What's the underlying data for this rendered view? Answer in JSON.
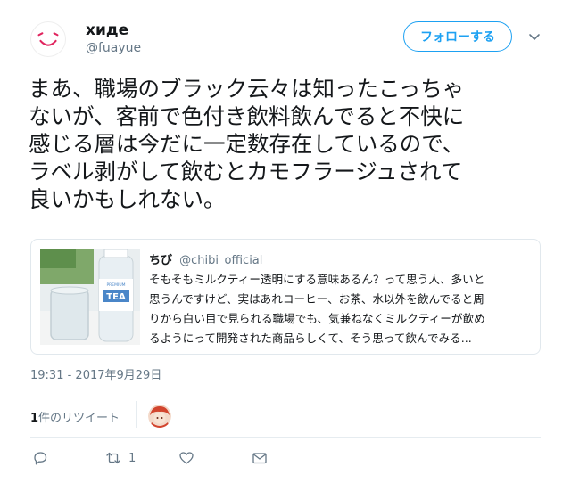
{
  "author": {
    "name": "хиде",
    "handle": "@fuayue",
    "follow_label": "フォローする"
  },
  "tweet": {
    "lines": [
      "まあ、職場のブラック云々は知ったこっちゃ",
      "ないが、客前で色付き飲料飲んでると不快に",
      "感じる層は今だに一定数存在しているので、",
      "ラベル剥がして飲むとカモフラージュされて",
      "良いかもしれない。"
    ]
  },
  "quote": {
    "name": "ちび",
    "handle": "@chibi_official",
    "lines": [
      "そもそもミルクティー透明にする意味あるん？って思う人、多いと",
      "思うんですけど、実はあれコーヒー、お茶、水以外を飲んでると周",
      "りから白い目で見られる職場でも、気兼ねなくミルクティーが飲め",
      "るようにって開発された商品らしくて、そう思って飲んでみる..."
    ]
  },
  "timestamp": "19:31 - 2017年9月29日",
  "retweets": {
    "count": "1",
    "label": "件のリツイート"
  },
  "actions": {
    "retweet_count": "1"
  },
  "colors": {
    "accent": "#1da1f2",
    "secondary_text": "#657786",
    "border": "#e1e8ed"
  }
}
